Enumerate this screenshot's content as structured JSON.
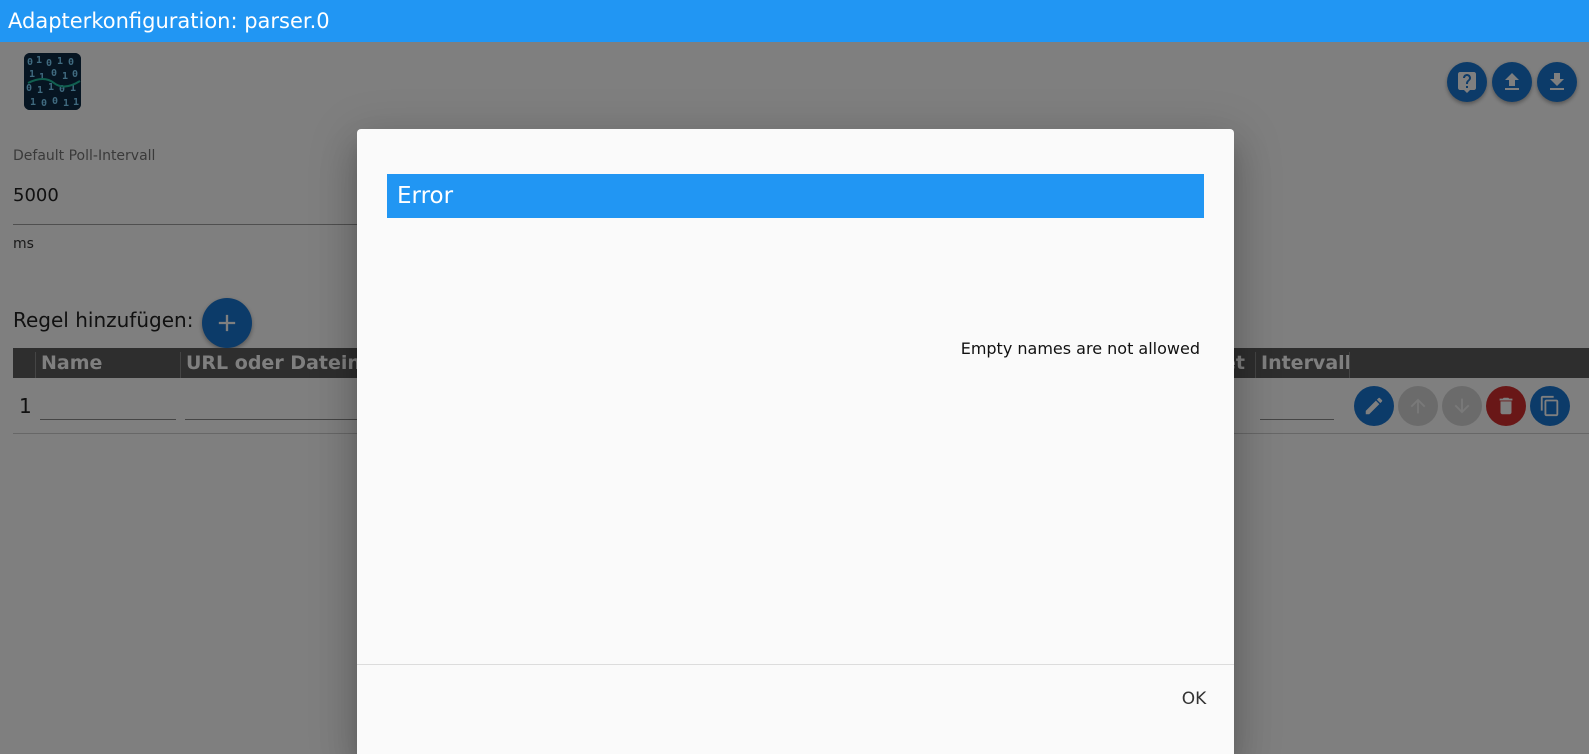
{
  "window": {
    "title": "Adapterkonfiguration: parser.0"
  },
  "toolbar": {
    "buttons": [
      {
        "name": "help",
        "icon": "help-icon"
      },
      {
        "name": "upload",
        "icon": "upload-icon"
      },
      {
        "name": "download",
        "icon": "download-icon"
      }
    ]
  },
  "settings": {
    "poll_label": "Default Poll-Intervall",
    "poll_value": "5000",
    "poll_unit": "ms"
  },
  "rules": {
    "add_label": "Regel hinzufügen:",
    "columns": [
      "Name",
      "URL oder Dateiname",
      "et",
      "Intervall"
    ],
    "rows": [
      {
        "index": "1"
      }
    ]
  },
  "dialog": {
    "title": "Error",
    "message": "Empty names are not allowed",
    "ok_label": "OK"
  },
  "colors": {
    "accent": "#2196f3",
    "button_blue": "#1976d2",
    "delete_red": "#d32f2f",
    "disabled_gray": "#d7d7d7"
  }
}
